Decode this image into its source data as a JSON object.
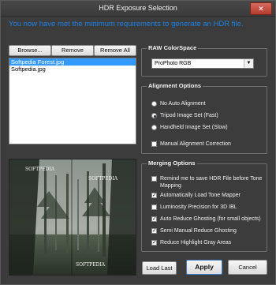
{
  "window": {
    "title": "HDR Exposure Selection",
    "close_symbol": "✕"
  },
  "banner": "You now have met the minimum requirements to generate an HDR file.",
  "toolbar": {
    "browse": "Browse...",
    "remove": "Remove",
    "remove_all": "Remove All"
  },
  "file_list": {
    "items": [
      "Softpedia Forest.jpg",
      "Softpedia.jpg"
    ],
    "selected_index": 0
  },
  "preview": {
    "watermarks": [
      "SOFTPEDIA",
      "SOFTPEDIA",
      "SOFTPEDIA"
    ]
  },
  "raw_colorspace": {
    "title": "RAW ColorSpace",
    "selected": "ProPhoto RGB"
  },
  "alignment": {
    "title": "Alignment Options",
    "radios": [
      {
        "label": "No Auto Alignment",
        "checked": false
      },
      {
        "label": "Tripod Image Set (Fast)",
        "checked": true
      },
      {
        "label": "Handheld Image Set (Slow)",
        "checked": false
      }
    ],
    "manual": {
      "label": "Manual Alignment Correction",
      "checked": false
    }
  },
  "merging": {
    "title": "Merging Options",
    "options": [
      {
        "label": "Remind me to save HDR File before Tone",
        "label2": "Mapping",
        "checked": false
      },
      {
        "label": "Automatically Load Tone Mapper",
        "checked": true
      },
      {
        "label": "Luminosity Precision for 3D IBL",
        "checked": false
      },
      {
        "label": "Auto Reduce Ghosting (for small objects)",
        "checked": true
      },
      {
        "label": "Semi Manual Reduce Ghosting",
        "checked": true
      },
      {
        "label": "Reduce Highlight Gray Areas",
        "checked": true
      }
    ]
  },
  "footer": {
    "load_last": "Load Last",
    "apply": "Apply",
    "cancel": "Cancel"
  },
  "colors": {
    "accent": "#1e7fe0",
    "background": "#3c3c3c",
    "selection": "#3399ff"
  },
  "icons": {
    "close": "close-icon",
    "dropdown": "chevron-down-icon",
    "check": "checkmark-icon"
  }
}
